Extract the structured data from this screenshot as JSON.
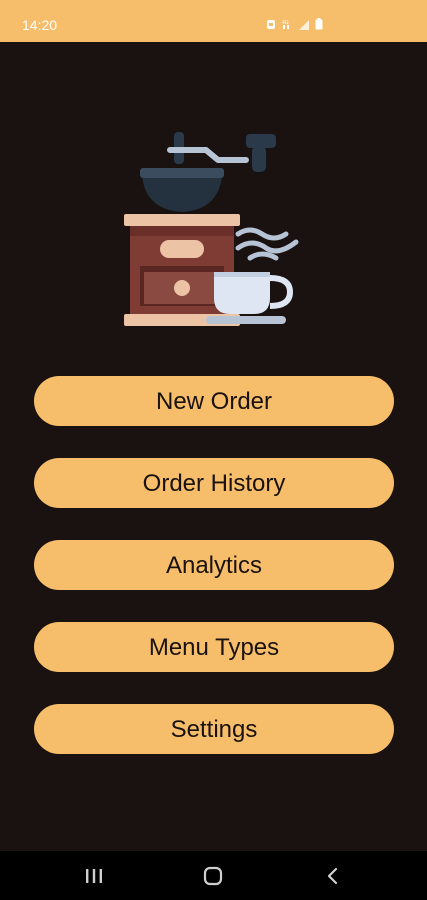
{
  "status_bar": {
    "time": "14:20",
    "icons": [
      "notification-icon",
      "wifi-icon",
      "signal-icon",
      "battery-icon"
    ]
  },
  "app": {
    "logo": "coffee-grinder-and-cup-illustration",
    "menu": [
      {
        "label": "New Order"
      },
      {
        "label": "Order History"
      },
      {
        "label": "Analytics"
      },
      {
        "label": "Menu Types"
      },
      {
        "label": "Settings"
      }
    ]
  },
  "nav_bar": {
    "buttons": [
      "recent-apps-icon",
      "home-icon",
      "back-icon"
    ]
  },
  "colors": {
    "background": "#1a1210",
    "accent": "#f6be6a",
    "button_text": "#1a1210"
  }
}
